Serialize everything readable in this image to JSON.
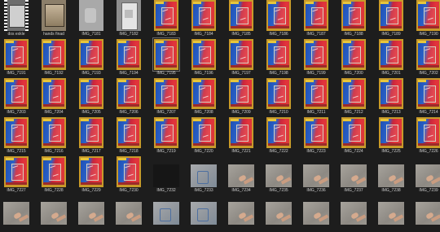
{
  "colors": {
    "background": "#1d1d1d",
    "label": "#cfcfcf"
  },
  "rows": [
    {
      "items": [
        {
          "label": "dos exkle",
          "kind": "film"
        },
        {
          "label": "hands finad",
          "kind": "hands"
        },
        {
          "label": "IMG_7181",
          "kind": "gray"
        },
        {
          "label": "IMG_7182",
          "kind": "door"
        },
        {
          "label": "IMG_7183",
          "kind": "poster"
        },
        {
          "label": "IMG_7184",
          "kind": "poster"
        },
        {
          "label": "IMG_7185",
          "kind": "poster"
        },
        {
          "label": "IMG_7186",
          "kind": "poster"
        },
        {
          "label": "IMG_7187",
          "kind": "poster"
        },
        {
          "label": "IMG_7188",
          "kind": "poster"
        },
        {
          "label": "IMG_7189",
          "kind": "poster"
        },
        {
          "label": "IMG_7190",
          "kind": "poster"
        }
      ]
    },
    {
      "items": [
        {
          "label": "IMG_7191",
          "kind": "poster"
        },
        {
          "label": "IMG_7192",
          "kind": "poster"
        },
        {
          "label": "IMG_7193",
          "kind": "poster"
        },
        {
          "label": "IMG_7194",
          "kind": "poster"
        },
        {
          "label": "IMG_7195",
          "kind": "poster",
          "selected": true
        },
        {
          "label": "IMG_7196",
          "kind": "poster"
        },
        {
          "label": "IMG_7197",
          "kind": "poster"
        },
        {
          "label": "IMG_7198",
          "kind": "poster"
        },
        {
          "label": "IMG_7199",
          "kind": "poster"
        },
        {
          "label": "IMG_7200",
          "kind": "poster"
        },
        {
          "label": "IMG_7201",
          "kind": "poster"
        },
        {
          "label": "IMG_7202",
          "kind": "poster"
        }
      ]
    },
    {
      "items": [
        {
          "label": "IMG_7203",
          "kind": "poster"
        },
        {
          "label": "IMG_7204",
          "kind": "poster"
        },
        {
          "label": "IMG_7205",
          "kind": "poster"
        },
        {
          "label": "IMG_7206",
          "kind": "poster"
        },
        {
          "label": "IMG_7207",
          "kind": "poster"
        },
        {
          "label": "IMG_7208",
          "kind": "poster"
        },
        {
          "label": "IMG_7209",
          "kind": "poster"
        },
        {
          "label": "IMG_7210",
          "kind": "poster"
        },
        {
          "label": "IMG_7211",
          "kind": "poster"
        },
        {
          "label": "IMG_7212",
          "kind": "poster"
        },
        {
          "label": "IMG_7213",
          "kind": "poster"
        },
        {
          "label": "IMG_7214",
          "kind": "poster"
        }
      ]
    },
    {
      "items": [
        {
          "label": "IMG_7215",
          "kind": "poster"
        },
        {
          "label": "IMG_7216",
          "kind": "poster"
        },
        {
          "label": "IMG_7217",
          "kind": "poster"
        },
        {
          "label": "IMG_7218",
          "kind": "poster"
        },
        {
          "label": "IMG_7219",
          "kind": "poster"
        },
        {
          "label": "IMG_7220",
          "kind": "poster"
        },
        {
          "label": "IMG_7221",
          "kind": "poster"
        },
        {
          "label": "IMG_7222",
          "kind": "poster"
        },
        {
          "label": "IMG_7223",
          "kind": "poster"
        },
        {
          "label": "IMG_7224",
          "kind": "poster"
        },
        {
          "label": "IMG_7225",
          "kind": "poster"
        },
        {
          "label": "IMG_7226",
          "kind": "poster"
        }
      ]
    },
    {
      "items": [
        {
          "label": "IMG_7227",
          "kind": "poster"
        },
        {
          "label": "IMG_7228",
          "kind": "poster"
        },
        {
          "label": "IMG_7229",
          "kind": "poster"
        },
        {
          "label": "IMG_7230",
          "kind": "poster"
        },
        {
          "label": "IMG_7232",
          "kind": "dark"
        },
        {
          "label": "IMG_7233",
          "kind": "blue"
        },
        {
          "label": "IMG_7234",
          "kind": "concrete"
        },
        {
          "label": "IMG_7235",
          "kind": "concrete"
        },
        {
          "label": "IMG_7236",
          "kind": "concrete"
        },
        {
          "label": "IMG_7237",
          "kind": "concrete"
        },
        {
          "label": "IMG_7238",
          "kind": "concrete"
        },
        {
          "label": "IMG_7239",
          "kind": "concrete"
        }
      ]
    },
    {
      "items": [
        {
          "label": "",
          "kind": "concrete"
        },
        {
          "label": "",
          "kind": "concrete"
        },
        {
          "label": "",
          "kind": "concrete"
        },
        {
          "label": "",
          "kind": "concrete"
        },
        {
          "label": "",
          "kind": "blue"
        },
        {
          "label": "",
          "kind": "blue"
        },
        {
          "label": "",
          "kind": "concrete"
        },
        {
          "label": "",
          "kind": "concrete"
        },
        {
          "label": "",
          "kind": "concrete"
        },
        {
          "label": "",
          "kind": "concrete"
        },
        {
          "label": "",
          "kind": "concrete"
        },
        {
          "label": "",
          "kind": "concrete"
        }
      ]
    }
  ]
}
